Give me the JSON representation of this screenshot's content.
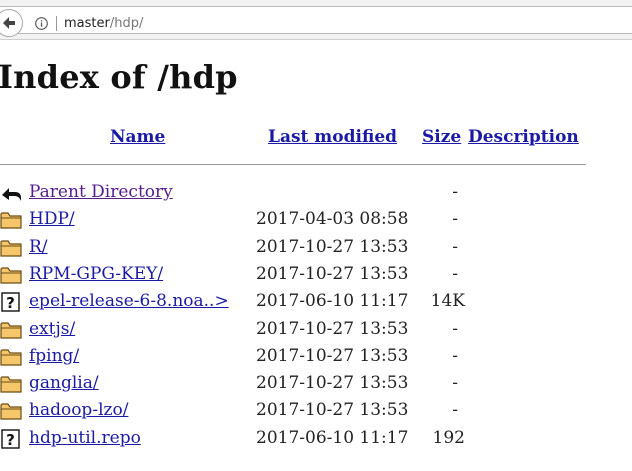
{
  "browser": {
    "url_host": "master",
    "url_path": "/hdp/"
  },
  "page": {
    "title": "Index of /hdp"
  },
  "table": {
    "headers": {
      "name": "Name",
      "last_modified": "Last modified",
      "size": "Size",
      "description": "Description"
    },
    "rows": [
      {
        "icon": "back-icon",
        "name": "Parent Directory",
        "date": "",
        "size": "-"
      },
      {
        "icon": "folder-icon",
        "name": "HDP/",
        "date": "2017-04-03 08:58",
        "size": "-"
      },
      {
        "icon": "folder-icon",
        "name": "R/",
        "date": "2017-10-27 13:53",
        "size": "-"
      },
      {
        "icon": "folder-icon",
        "name": "RPM-GPG-KEY/",
        "date": "2017-10-27 13:53",
        "size": "-"
      },
      {
        "icon": "unknown-file-icon",
        "name": "epel-release-6-8.noa..>",
        "date": "2017-06-10 11:17",
        "size": "14K"
      },
      {
        "icon": "folder-icon",
        "name": "extjs/",
        "date": "2017-10-27 13:53",
        "size": "-"
      },
      {
        "icon": "folder-icon",
        "name": "fping/",
        "date": "2017-10-27 13:53",
        "size": "-"
      },
      {
        "icon": "folder-icon",
        "name": "ganglia/",
        "date": "2017-10-27 13:53",
        "size": "-"
      },
      {
        "icon": "folder-icon",
        "name": "hadoop-lzo/",
        "date": "2017-10-27 13:53",
        "size": "-"
      },
      {
        "icon": "unknown-file-icon",
        "name": "hdp-util.repo",
        "date": "2017-06-10 11:17",
        "size": "192"
      }
    ]
  }
}
